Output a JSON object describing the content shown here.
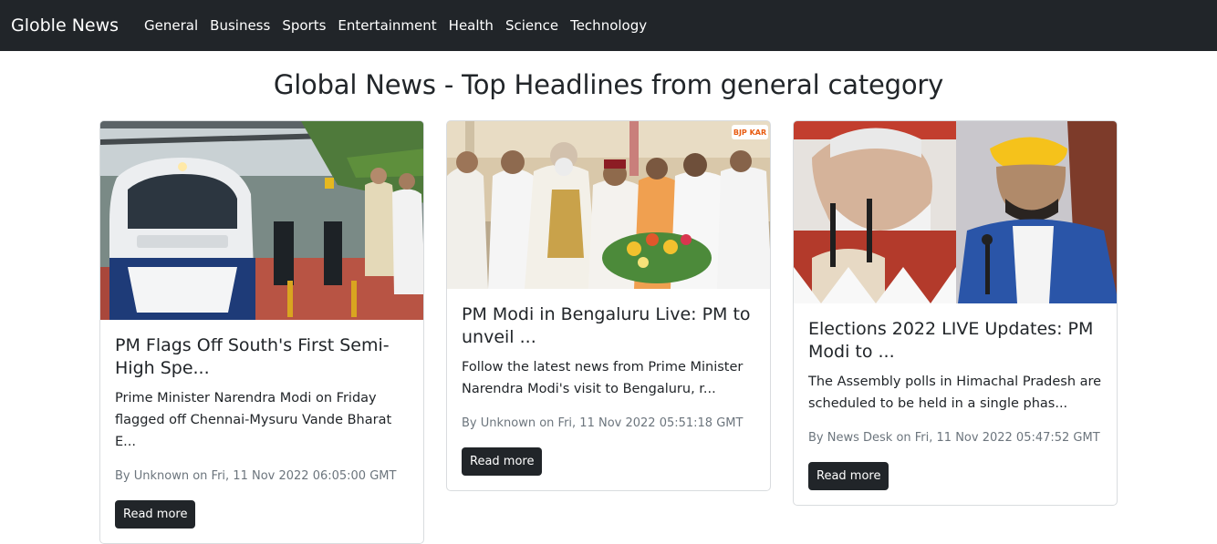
{
  "nav": {
    "brand": "Globle News",
    "links": [
      "General",
      "Business",
      "Sports",
      "Entertainment",
      "Health",
      "Science",
      "Technology"
    ]
  },
  "page": {
    "title": "Global News - Top Headlines from general category"
  },
  "articles": [
    {
      "title": "PM Flags Off South's First Semi-High Spe...",
      "description": "Prime Minister Narendra Modi on Friday flagged off Chennai-Mysuru Vande Bharat E...",
      "meta": "By Unknown on Fri, 11 Nov 2022 06:05:00 GMT",
      "button": "Read more",
      "image_alt": "Train flag-off photo"
    },
    {
      "title": "PM Modi in Bengaluru Live: PM to unveil ...",
      "description": "Follow the latest news from Prime Minister Narendra Modi's visit to Bengaluru, r...",
      "meta": "By Unknown on Fri, 11 Nov 2022 05:51:18 GMT",
      "button": "Read more",
      "image_alt": "Event stage photo",
      "badge": "BJP KAR LIVE"
    },
    {
      "title": "Elections 2022 LIVE Updates: PM Modi to ...",
      "description": "The Assembly polls in Himachal Pradesh are scheduled to be held in a single phas...",
      "meta": "By News Desk on Fri, 11 Nov 2022 05:47:52 GMT",
      "button": "Read more",
      "image_alt": "Split portrait photo"
    }
  ]
}
